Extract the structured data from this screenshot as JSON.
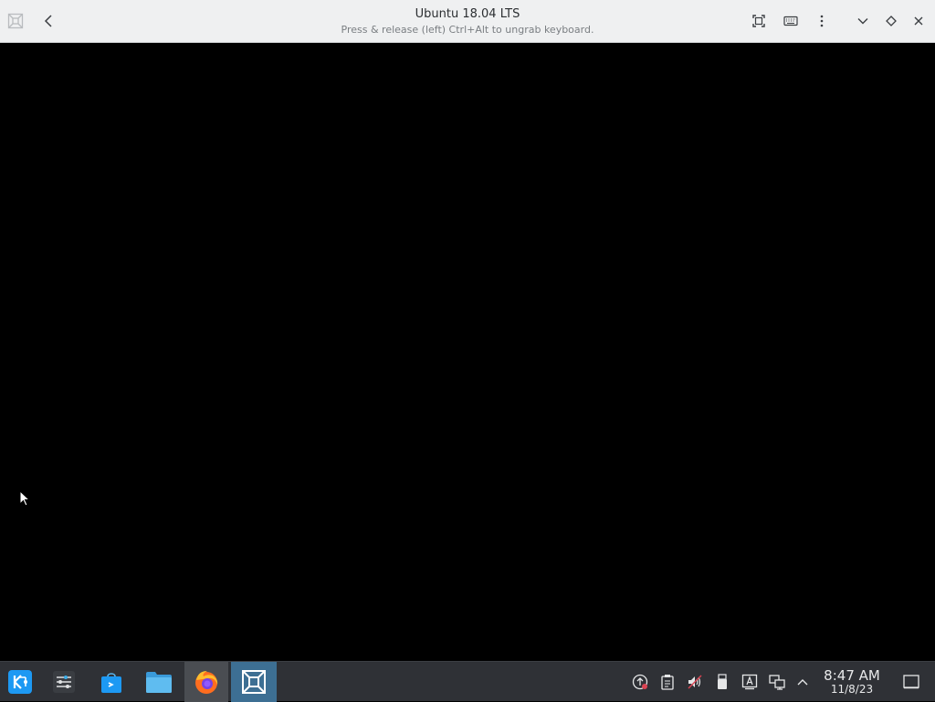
{
  "window": {
    "title": "Ubuntu 18.04 LTS",
    "subtitle": "Press & release (left) Ctrl+Alt to ungrab keyboard."
  },
  "titlebar_icons": {
    "app": "vm-app-icon",
    "back": "back-arrow-icon",
    "fullscreen": "fullscreen-icon",
    "keyboard": "keyboard-icon",
    "menu": "kebab-menu-icon",
    "minimize": "chevron-down-icon",
    "maximize": "diamond-icon",
    "close": "close-icon"
  },
  "taskbar": {
    "launcher": "kde-application-launcher",
    "items": [
      {
        "name": "system-settings",
        "active": false
      },
      {
        "name": "discover-store",
        "active": false
      },
      {
        "name": "file-manager",
        "active": false
      },
      {
        "name": "firefox",
        "active": true
      },
      {
        "name": "virtual-machine-manager",
        "active": true
      }
    ],
    "tray": [
      "updates-icon",
      "clipboard-icon",
      "volume-muted-icon",
      "usb-device-icon",
      "input-method-icon",
      "network-wired-icon",
      "expand-tray-icon"
    ],
    "clock": {
      "time": "8:47 AM",
      "date": "11/8/23"
    },
    "show_desktop": "show-desktop-icon"
  },
  "colors": {
    "titlebar_bg": "#eff0f1",
    "taskbar_bg": "#2f3136",
    "accent": "#3daee9"
  }
}
